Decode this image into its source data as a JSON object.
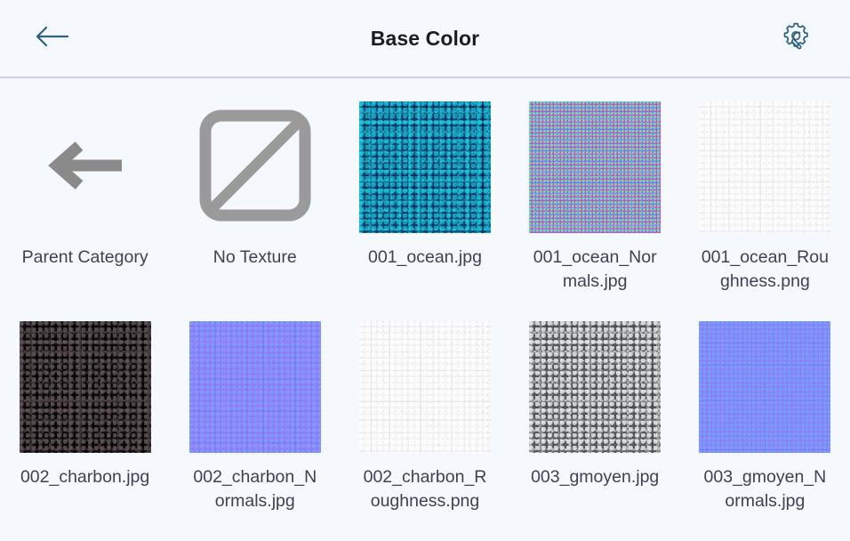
{
  "header": {
    "title": "Base Color",
    "back_icon": "arrow-left-icon",
    "settings_icon": "gear-wrench-icon"
  },
  "grid": {
    "items": [
      {
        "id": "parent-category",
        "label": "Parent Category",
        "kind": "navigation",
        "icon": "arrow-left-icon",
        "wrap": "word"
      },
      {
        "id": "no-texture",
        "label": "No Texture",
        "kind": "clear",
        "icon": "no-texture-icon",
        "wrap": "word"
      },
      {
        "id": "001_ocean",
        "label": "001_ocean.jpg",
        "kind": "texture",
        "swatch": "tex-ocean",
        "wrap": "break"
      },
      {
        "id": "001_ocean_Normals",
        "label": "001_ocean_Normals.jpg",
        "kind": "texture",
        "swatch": "tex-ocean-n",
        "wrap": "break"
      },
      {
        "id": "001_ocean_Roughness",
        "label": "001_ocean_Roughness.png",
        "kind": "texture",
        "swatch": "tex-ocean-r",
        "wrap": "break"
      },
      {
        "id": "002_charbon",
        "label": "002_charbon.jpg",
        "kind": "texture",
        "swatch": "tex-charbon",
        "wrap": "break"
      },
      {
        "id": "002_charbon_Normals",
        "label": "002_charbon_Normals.jpg",
        "kind": "texture",
        "swatch": "tex-charbon-n",
        "wrap": "break"
      },
      {
        "id": "002_charbon_Roughness",
        "label": "002_charbon_Roughness.png",
        "kind": "texture",
        "swatch": "tex-charbon-r",
        "wrap": "break"
      },
      {
        "id": "003_gmoyen",
        "label": "003_gmoyen.jpg",
        "kind": "texture",
        "swatch": "tex-gmoyen",
        "wrap": "break"
      },
      {
        "id": "003_gmoyen_Normals",
        "label": "003_gmoyen_Normals.jpg",
        "kind": "texture",
        "swatch": "tex-gmoyen-n",
        "wrap": "break"
      }
    ]
  },
  "colors": {
    "background": "#f5f8fd",
    "divider": "#ccd3e0",
    "title_text": "#1b1d22",
    "label_text": "#3c4250",
    "accent_icon": "#2c6182",
    "placeholder_icon": "#959595"
  }
}
